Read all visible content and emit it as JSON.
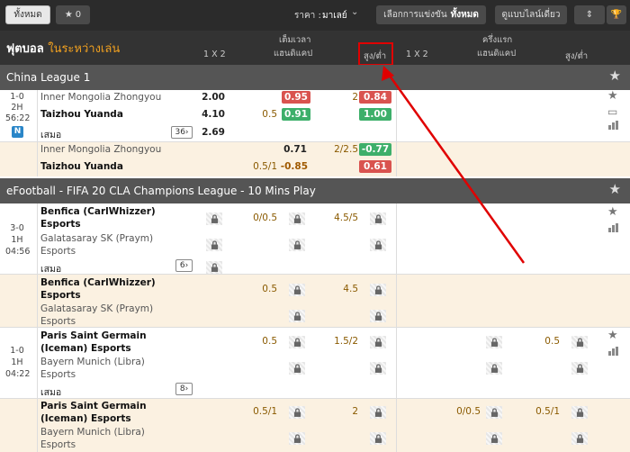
{
  "topbar": {
    "all_label": "ทั้งหมด",
    "fav_count": "0",
    "price_label": "ราคา :",
    "price_value": "มาเลย์",
    "select_label": "เลือกการแข่งขัน",
    "select_value": "ทั้งหมด",
    "view_label": "ดูแบบไลน์เดี่ยว"
  },
  "header": {
    "title": "ฟุตบอล",
    "subtitle": "ในระหว่างเล่น",
    "full_time": "เต็มเวลา",
    "first_half": "ครึ่งแรก",
    "col_1x2": "1 X 2",
    "col_handicap": "แฮนดิแคป",
    "col_ou": "สูง/ต่ำ"
  },
  "leagues": [
    {
      "name": "China League 1",
      "match": {
        "score": "1-0",
        "period": "2H",
        "time": "56:22",
        "badge": "N",
        "home": "Inner Mongolia Zhongyou",
        "away": "Taizhou Yuanda",
        "draw": "เสมอ",
        "count": "36",
        "line1": {
          "x1": "2.00",
          "x2": "4.10",
          "xd": "2.69",
          "hcap_home": "0.95",
          "hcap_away_line": "0.5",
          "hcap_away": "0.91",
          "ou_line": "2",
          "ou_over": "0.84",
          "ou_under": "1.00"
        },
        "line2": {
          "hcap_home": "0.71",
          "hcap_away_line": "0.5/1",
          "hcap_away": "-0.85",
          "ou_line": "2/2.5",
          "ou_over": "-0.77",
          "ou_under": "0.61"
        }
      }
    },
    {
      "name": "eFootball - FIFA 20 CLA Champions League - 10 Mins Play",
      "matches": [
        {
          "score": "3-0",
          "period": "1H",
          "time": "04:56",
          "home1": "Benfica (CarlWhizzer)",
          "home2": "Esports",
          "away1": "Galatasaray SK (Praym)",
          "away2": "Esports",
          "draw": "เสมอ",
          "count": "6",
          "line1": {
            "hcap": "0/0.5",
            "ou": "4.5/5"
          },
          "line2": {
            "hcap": "0.5",
            "ou": "4.5"
          }
        },
        {
          "score": "1-0",
          "period": "1H",
          "time": "04:22",
          "home1": "Paris Saint Germain",
          "home2": "(Iceman) Esports",
          "away1": "Bayern Munich (Libra)",
          "away2": "Esports",
          "draw": "เสมอ",
          "count": "8",
          "line1": {
            "hcap": "0.5",
            "ou": "1.5/2",
            "fh_ou": "0.5"
          },
          "line2": {
            "hcap": "0.5/1",
            "ou": "2",
            "fh_hcap": "0/0.5",
            "fh_ou": "0.5/1"
          }
        }
      ]
    }
  ],
  "colors": {
    "accent": "#f0a020",
    "red": "#d9534f",
    "green": "#3daf6a",
    "highlight": "#e00000"
  }
}
